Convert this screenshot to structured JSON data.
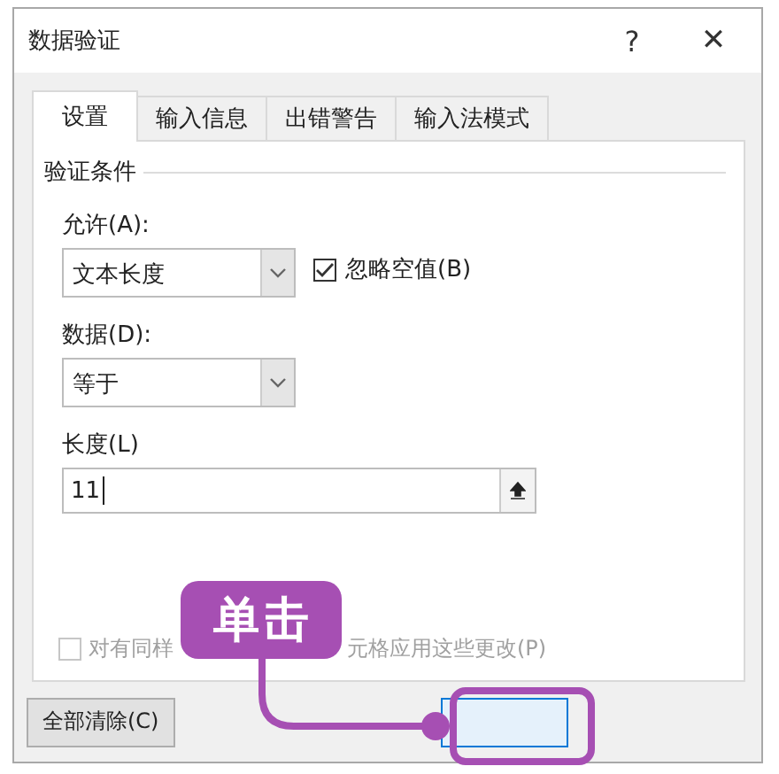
{
  "window": {
    "title": "数据验证",
    "help": "?",
    "close": "✕"
  },
  "tabs": [
    {
      "label": "设置",
      "selected": true
    },
    {
      "label": "输入信息",
      "selected": false
    },
    {
      "label": "出错警告",
      "selected": false
    },
    {
      "label": "输入法模式",
      "selected": false
    }
  ],
  "section": "验证条件",
  "allow": {
    "label": "允许(A):",
    "value": "文本长度"
  },
  "ignore_blank": {
    "label": "忽略空值(B)",
    "checked": true
  },
  "data": {
    "label": "数据(D):",
    "value": "等于"
  },
  "length": {
    "label": "长度(L)",
    "value": "11"
  },
  "apply_all": {
    "checked": false,
    "disabled": true,
    "visible_parts": [
      "对有同样",
      "元格应用这些更改(P)"
    ]
  },
  "buttons": [
    {
      "label": "全部清除(C)",
      "focused": false
    },
    {
      "focused": true
    }
  ],
  "callout": {
    "text": "单击"
  }
}
